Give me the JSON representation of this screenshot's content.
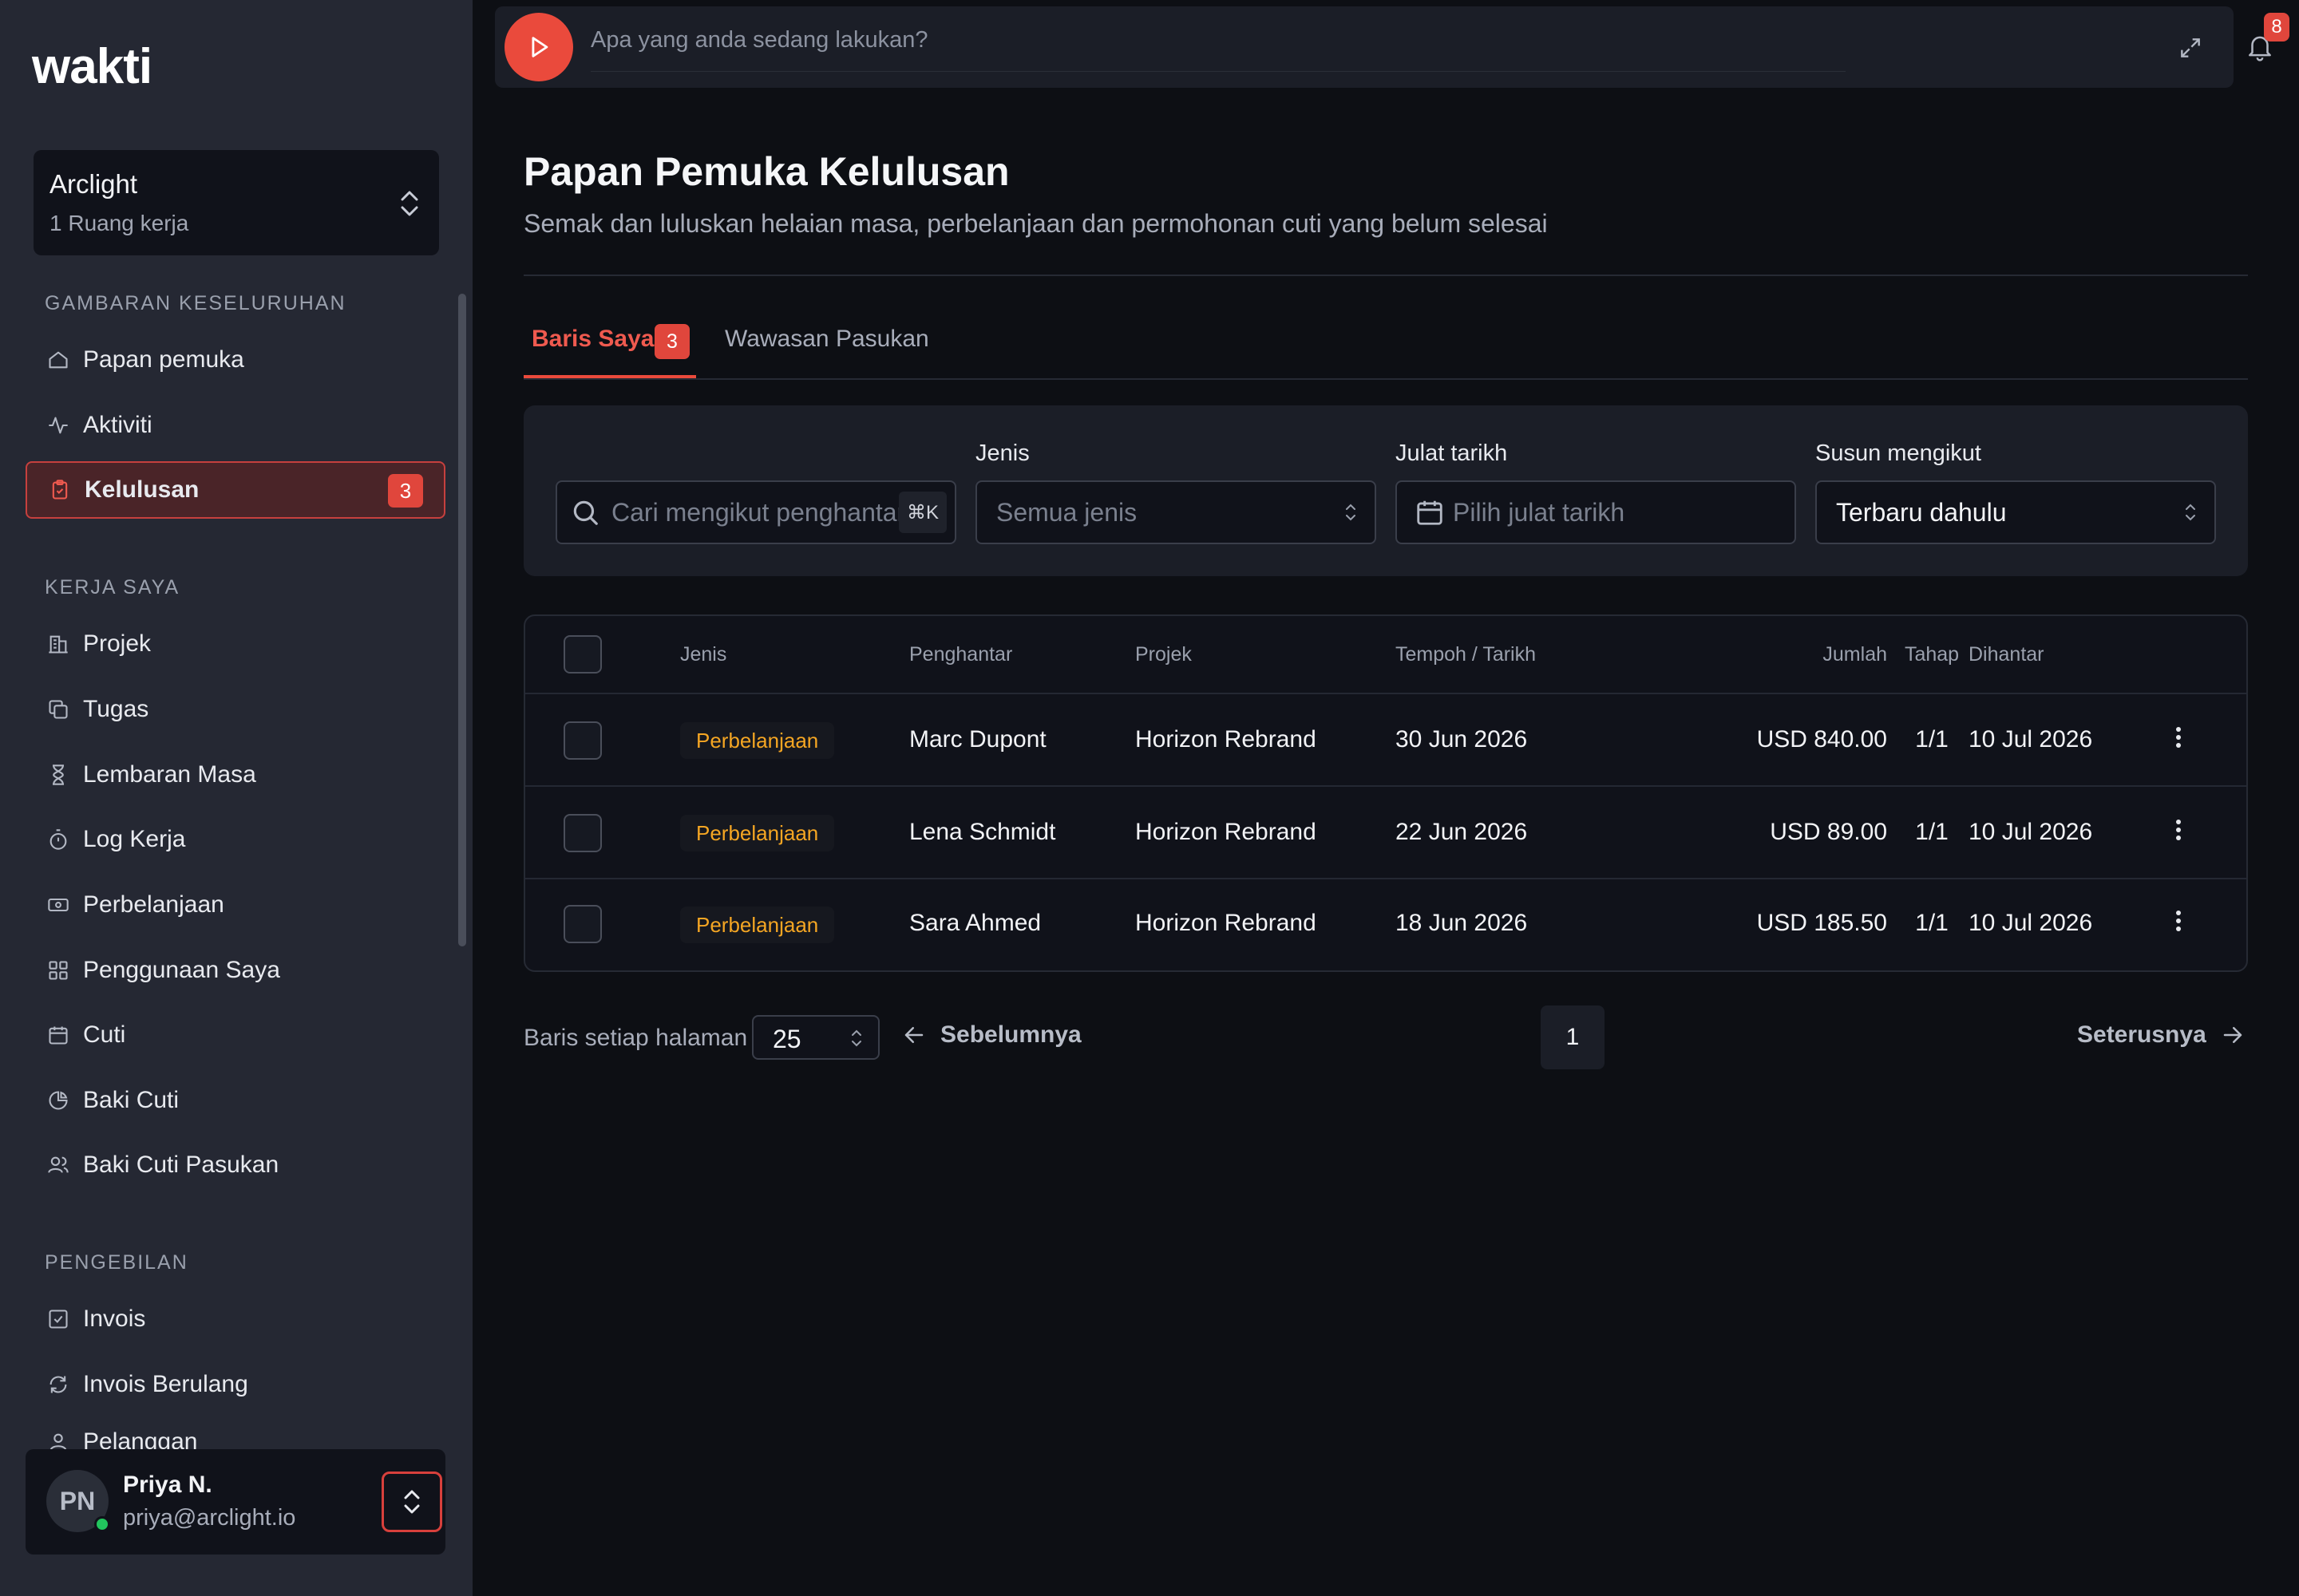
{
  "app": {
    "logo": "wakti"
  },
  "workspace": {
    "name": "Arclight",
    "subtitle": "1 Ruang kerja"
  },
  "sidebar": {
    "sections": [
      {
        "label": "GAMBARAN KESELURUHAN"
      },
      {
        "label": "KERJA SAYA"
      },
      {
        "label": "PENGEBILAN"
      }
    ],
    "overview": [
      {
        "label": "Papan pemuka",
        "icon": "home-icon"
      },
      {
        "label": "Aktiviti",
        "icon": "activity-icon"
      },
      {
        "label": "Kelulusan",
        "icon": "clipboard-check-icon",
        "badge": "3",
        "active": true
      }
    ],
    "work": [
      {
        "label": "Projek",
        "icon": "building-icon"
      },
      {
        "label": "Tugas",
        "icon": "copy-icon"
      },
      {
        "label": "Lembaran Masa",
        "icon": "hourglass-icon"
      },
      {
        "label": "Log Kerja",
        "icon": "timer-icon"
      },
      {
        "label": "Perbelanjaan",
        "icon": "banknote-icon"
      },
      {
        "label": "Penggunaan Saya",
        "icon": "grid-icon"
      },
      {
        "label": "Cuti",
        "icon": "calendar-icon"
      },
      {
        "label": "Baki Cuti",
        "icon": "pie-chart-icon"
      },
      {
        "label": "Baki Cuti Pasukan",
        "icon": "users-icon"
      }
    ],
    "billing": [
      {
        "label": "Invois",
        "icon": "check-square-icon"
      },
      {
        "label": "Invois Berulang",
        "icon": "refresh-icon"
      },
      {
        "label": "Pelanggan",
        "icon": "user-icon"
      }
    ]
  },
  "user": {
    "initials": "PN",
    "name": "Priya N.",
    "email": "priya@arclight.io"
  },
  "topbar": {
    "placeholder": "Apa yang anda sedang lakukan?",
    "notification_count": "8"
  },
  "page": {
    "title": "Papan Pemuka Kelulusan",
    "subtitle": "Semak dan luluskan helaian masa, perbelanjaan dan permohonan cuti yang belum selesai"
  },
  "tabs": [
    {
      "label": "Baris Saya",
      "badge": "3",
      "active": true
    },
    {
      "label": "Wawasan Pasukan"
    }
  ],
  "filters": {
    "search_placeholder": "Cari mengikut penghantar",
    "search_shortcut": "⌘K",
    "type_label": "Jenis",
    "type_placeholder": "Semua jenis",
    "date_label": "Julat tarikh",
    "date_placeholder": "Pilih julat tarikh",
    "sort_label": "Susun mengikut",
    "sort_value": "Terbaru dahulu"
  },
  "table": {
    "columns": [
      "Jenis",
      "Penghantar",
      "Projek",
      "Tempoh / Tarikh",
      "Jumlah",
      "Tahap",
      "Dihantar"
    ],
    "rows": [
      {
        "type": "Perbelanjaan",
        "submitter": "Marc Dupont",
        "project": "Horizon Rebrand",
        "period": "30 Jun 2026",
        "amount": "USD 840.00",
        "stage": "1/1",
        "submitted": "10 Jul 2026"
      },
      {
        "type": "Perbelanjaan",
        "submitter": "Lena Schmidt",
        "project": "Horizon Rebrand",
        "period": "22 Jun 2026",
        "amount": "USD 89.00",
        "stage": "1/1",
        "submitted": "10 Jul 2026"
      },
      {
        "type": "Perbelanjaan",
        "submitter": "Sara Ahmed",
        "project": "Horizon Rebrand",
        "period": "18 Jun 2026",
        "amount": "USD 185.50",
        "stage": "1/1",
        "submitted": "10 Jul 2026"
      }
    ]
  },
  "pagination": {
    "rows_per_page_label": "Baris setiap halaman",
    "rows_per_page": "25",
    "prev_label": "Sebelumnya",
    "current_page": "1",
    "next_label": "Seterusnya"
  },
  "colors": {
    "accent": "#ea4a3c",
    "chip_text": "#f5a623",
    "sidebar_bg": "#252833",
    "main_bg": "#0d0f14"
  }
}
